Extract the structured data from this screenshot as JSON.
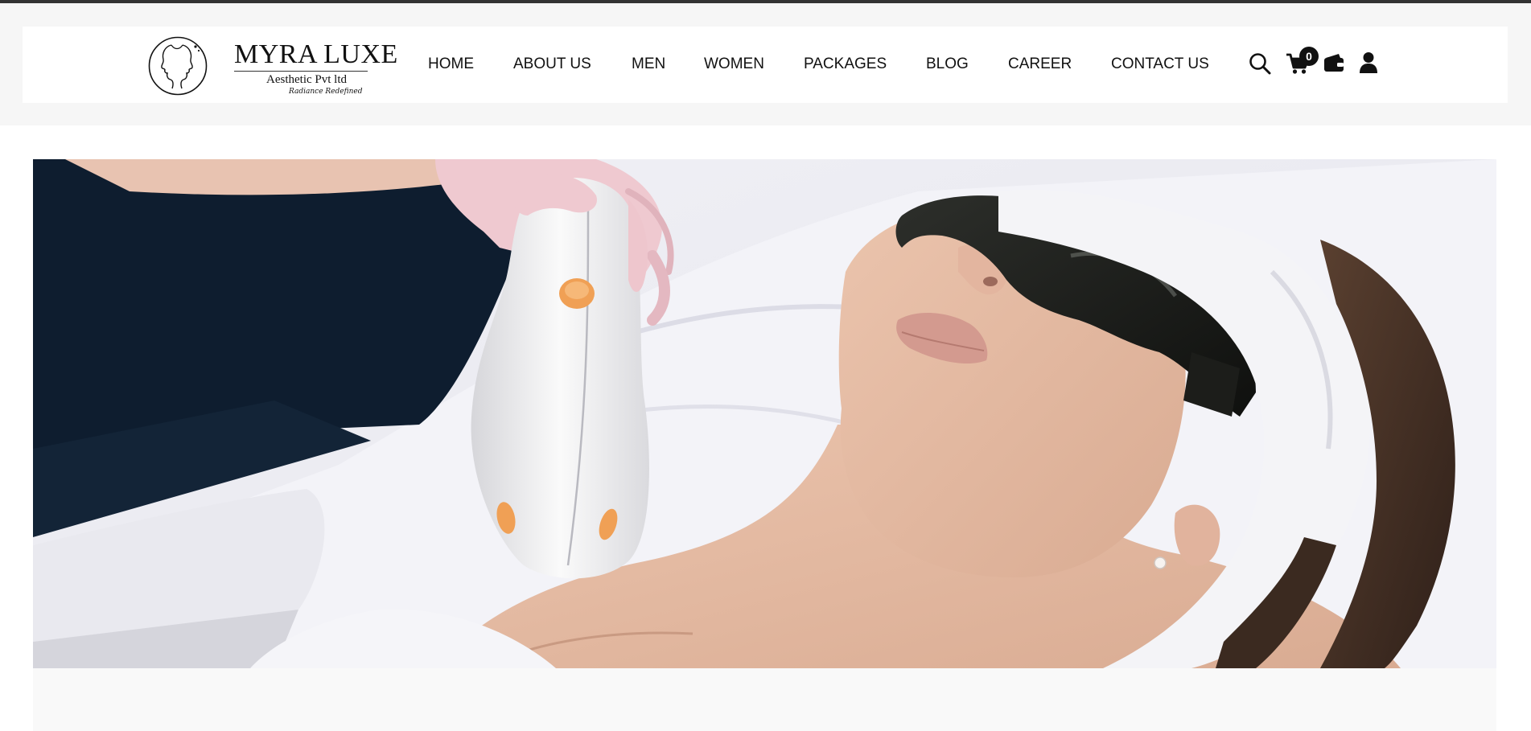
{
  "brand": {
    "name": "MYRA LUXE",
    "subtitle": "Aesthetic Pvt ltd",
    "tagline": "Radiance Redefined",
    "logo_icon": "faces-profile-logo-icon"
  },
  "nav": {
    "items": [
      {
        "label": "HOME"
      },
      {
        "label": "ABOUT US"
      },
      {
        "label": "MEN"
      },
      {
        "label": "WOMEN"
      },
      {
        "label": "PACKAGES"
      },
      {
        "label": "BLOG"
      },
      {
        "label": "CAREER"
      },
      {
        "label": "CONTACT US"
      }
    ]
  },
  "header_icons": {
    "search": "search-icon",
    "cart": "cart-icon",
    "cart_count": "0",
    "wallet": "wallet-icon",
    "account": "user-icon"
  },
  "hero": {
    "image": "laser-hair-removal-treatment-photo"
  },
  "colors": {
    "text": "#111111",
    "header_band": "#f6f6f6",
    "top_border": "#333333",
    "hero_accent": "#f0a055"
  }
}
